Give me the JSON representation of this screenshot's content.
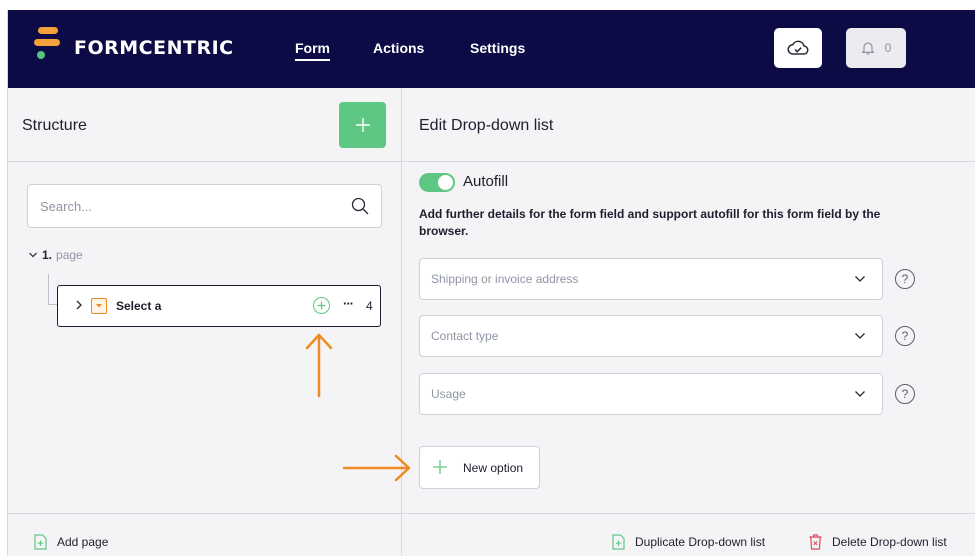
{
  "app": {
    "brand": "FORMCENTRIC",
    "nav": [
      {
        "label": "Form",
        "active": true
      },
      {
        "label": "Actions",
        "active": false
      },
      {
        "label": "Settings",
        "active": false
      }
    ],
    "notifications_count": "0",
    "brand_colors": {
      "navy": "#0d0b45",
      "orange": "#f5a13b",
      "green": "#5fc784"
    }
  },
  "structure": {
    "title": "Structure",
    "search_placeholder": "Search...",
    "page": {
      "number": "1.",
      "label": "page"
    },
    "item": {
      "label": "Select a",
      "count": "4",
      "more": "···"
    }
  },
  "edit": {
    "title": "Edit Drop-down list",
    "autofill": {
      "label": "Autofill",
      "enabled": true
    },
    "description": "Add further details for the form field and support autofill for this form field by the browser.",
    "selects": [
      {
        "placeholder": "Shipping or invoice address",
        "help": "?"
      },
      {
        "placeholder": "Contact type",
        "help": "?"
      },
      {
        "placeholder": "Usage",
        "help": "?"
      }
    ],
    "new_option": "New option"
  },
  "footer": {
    "add_page": "Add page",
    "duplicate": "Duplicate Drop-down list",
    "delete": "Delete Drop-down list"
  },
  "annotations": {
    "arrow_color": "#f08a24"
  }
}
